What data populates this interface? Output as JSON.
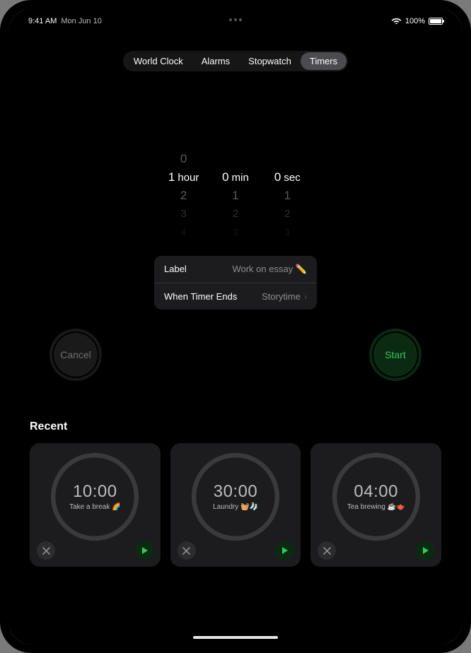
{
  "status": {
    "time": "9:41 AM",
    "date": "Mon Jun 10",
    "battery_pct": "100%"
  },
  "nav": {
    "items": [
      "World Clock",
      "Alarms",
      "Stopwatch",
      "Timers"
    ],
    "active_index": 3
  },
  "picker": {
    "hours": {
      "value": "1",
      "unit": "hour",
      "above": [
        "0"
      ],
      "below": [
        "2",
        "3",
        "4"
      ]
    },
    "minutes": {
      "value": "0",
      "unit": "min",
      "above": [],
      "below": [
        "1",
        "2",
        "3"
      ]
    },
    "seconds": {
      "value": "0",
      "unit": "sec",
      "above": [],
      "below": [
        "1",
        "2",
        "3"
      ]
    }
  },
  "options": {
    "label_title": "Label",
    "label_value": "Work on essay ✏️",
    "ends_title": "When Timer Ends",
    "ends_value": "Storytime"
  },
  "buttons": {
    "cancel": "Cancel",
    "start": "Start"
  },
  "recent": {
    "heading": "Recent",
    "items": [
      {
        "time": "10:00",
        "label": "Take a break 🌈"
      },
      {
        "time": "30:00",
        "label": "Laundry 🧺🧦"
      },
      {
        "time": "04:00",
        "label": "Tea brewing ☕️🫖"
      }
    ]
  }
}
